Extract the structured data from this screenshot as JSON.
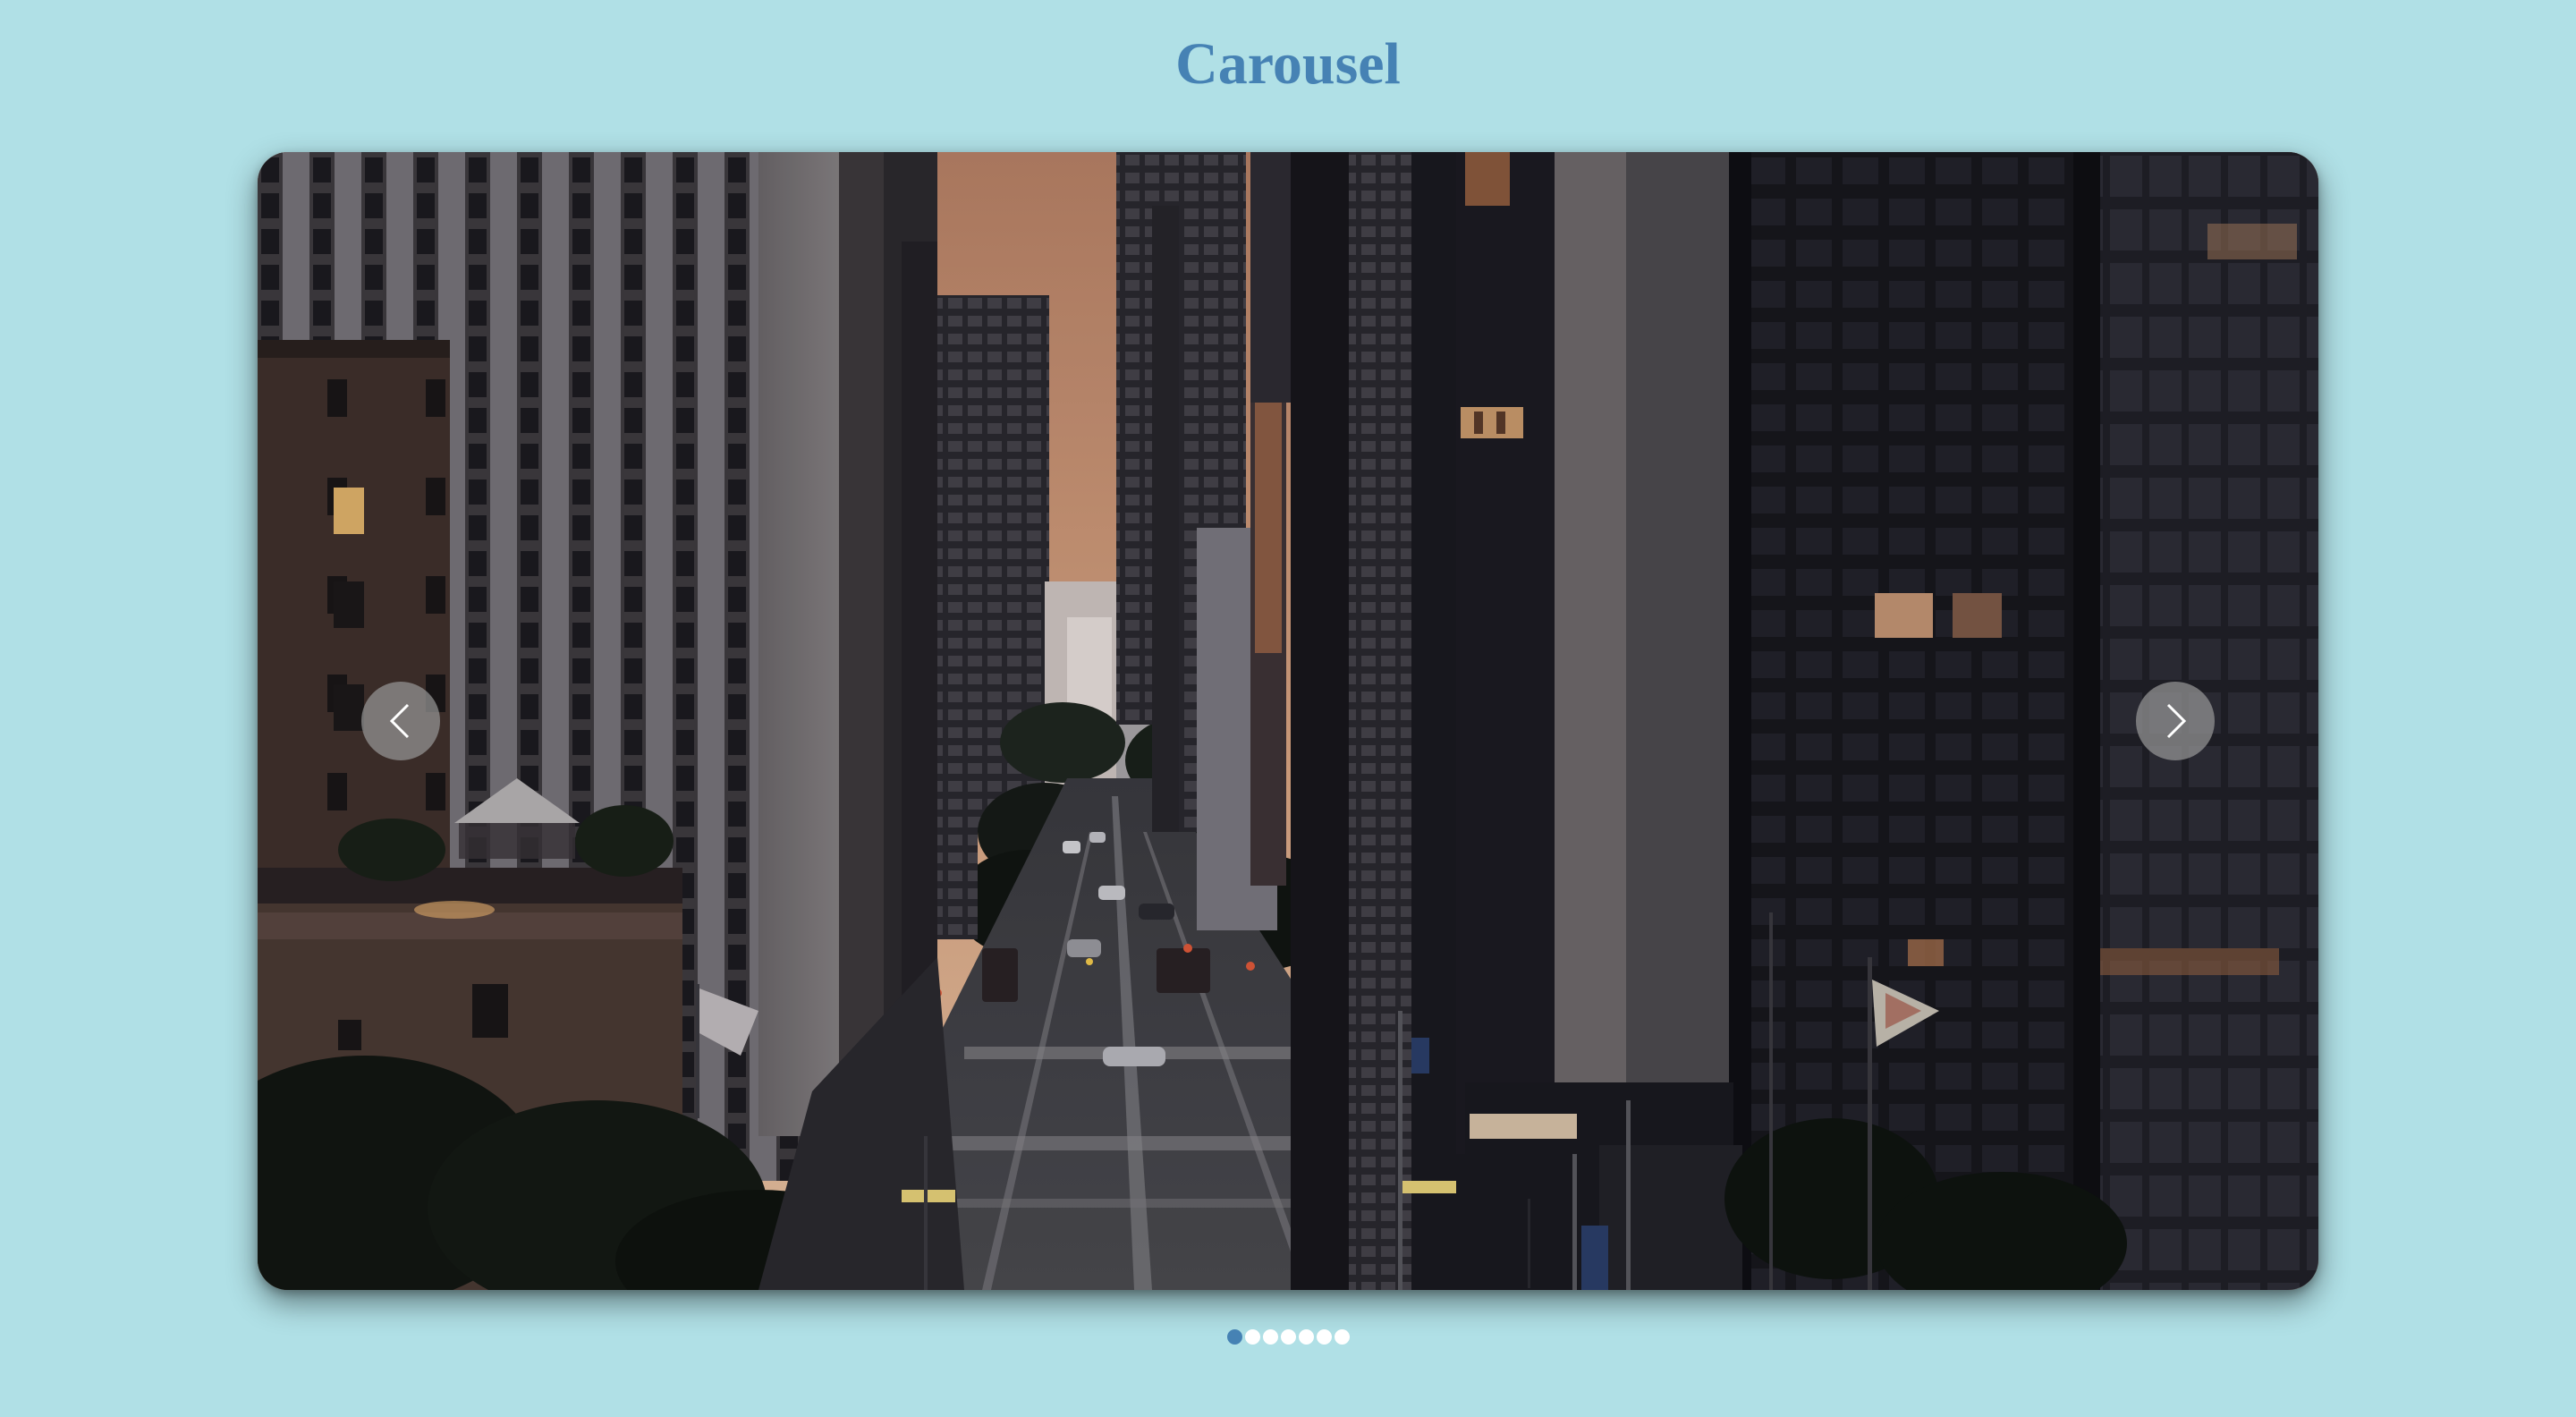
{
  "page": {
    "title": "Carousel"
  },
  "carousel": {
    "current_slide": 1,
    "slide_count": 7,
    "slide_image": "city-street-dusk-photo",
    "prev_button_icon": "chevron-left-icon",
    "next_button_icon": "chevron-right-icon"
  },
  "colors": {
    "background": "#b0e0e6",
    "title": "#4682b4",
    "dot_active": "#4682b4",
    "dot_inactive": "#ffffff"
  }
}
